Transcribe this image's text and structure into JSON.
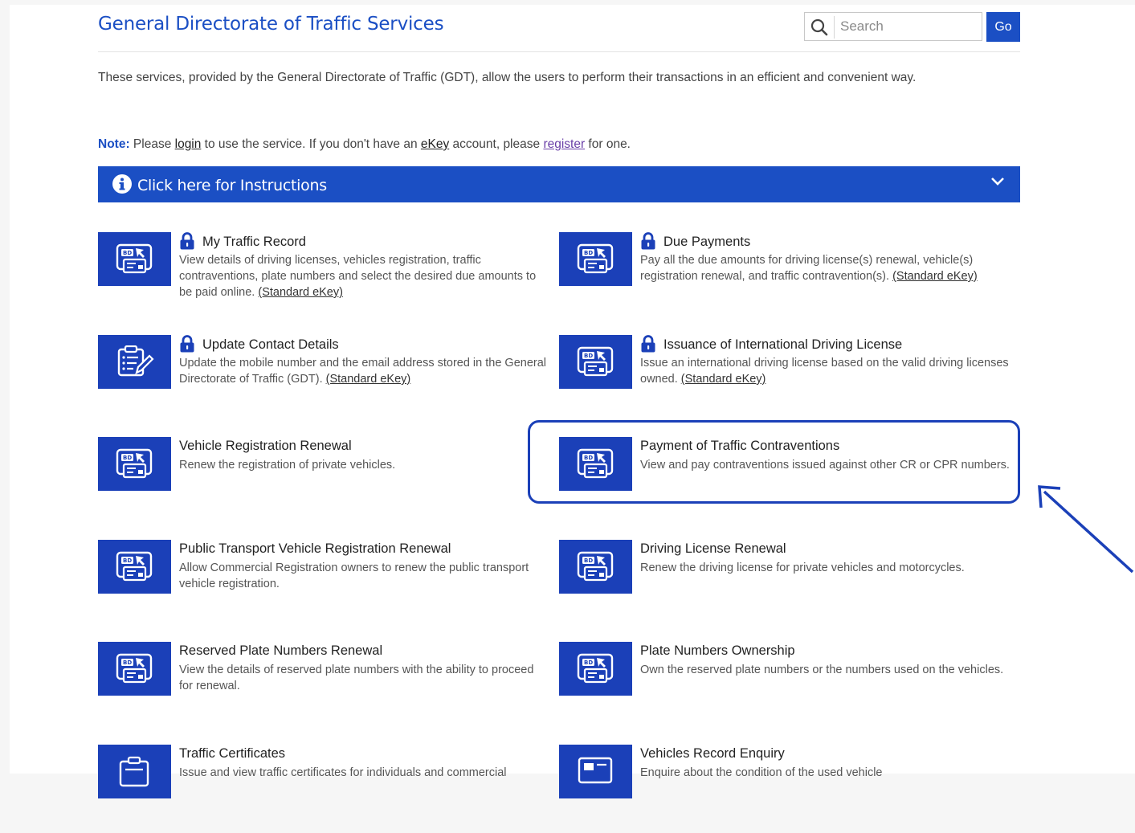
{
  "header": {
    "title": "General Directorate of Traffic Services",
    "search_placeholder": "Search",
    "go_label": "Go"
  },
  "intro": "These services, provided by the General Directorate of Traffic (GDT), allow the users to perform their transactions in an efficient and convenient way.",
  "note": {
    "label": "Note:",
    "t1": " Please ",
    "login": "login",
    "t2": " to use the service. If you don't have an ",
    "ekey": "eKey",
    "t3": " account, please ",
    "register": "register",
    "t4": " for one."
  },
  "instructions": {
    "label": "Click here for Instructions"
  },
  "services": [
    {
      "title": "My Traffic Record",
      "locked": true,
      "desc": "View details of driving licenses, vehicles registration, traffic contraventions, plate numbers and select the desired due amounts to be paid online. ",
      "ekey": "(Standard eKey)"
    },
    {
      "title": "Due Payments",
      "locked": true,
      "desc": "Pay all the due amounts for driving license(s) renewal, vehicle(s) registration renewal, and traffic contravention(s). ",
      "ekey": "(Standard eKey)"
    },
    {
      "title": "Update Contact Details",
      "locked": true,
      "desc": "Update the mobile number and the email address stored in the General Directorate of Traffic (GDT). ",
      "ekey": "(Standard eKey)"
    },
    {
      "title": "Issuance of International Driving License",
      "locked": true,
      "desc": "Issue an international driving license based on the valid driving licenses owned. ",
      "ekey": "(Standard eKey)"
    },
    {
      "title": "Vehicle Registration Renewal",
      "locked": false,
      "desc": "Renew the registration of private vehicles.",
      "ekey": ""
    },
    {
      "title": "Payment of Traffic Contraventions",
      "locked": false,
      "desc": "View and pay contraventions issued against other CR or CPR numbers.",
      "ekey": ""
    },
    {
      "title": "Public Transport Vehicle Registration Renewal",
      "locked": false,
      "desc": "Allow Commercial Registration owners to renew the public transport vehicle registration.",
      "ekey": ""
    },
    {
      "title": "Driving License Renewal",
      "locked": false,
      "desc": "Renew the driving license for private vehicles and motorcycles.",
      "ekey": ""
    },
    {
      "title": "Reserved Plate Numbers Renewal",
      "locked": false,
      "desc": "View the details of reserved plate numbers with the ability to proceed for renewal.",
      "ekey": ""
    },
    {
      "title": "Plate Numbers Ownership",
      "locked": false,
      "desc": "Own the reserved plate numbers or the numbers used on the vehicles.",
      "ekey": ""
    },
    {
      "title": "Traffic Certificates",
      "locked": false,
      "desc": "Issue and view traffic certificates for individuals and commercial",
      "ekey": ""
    },
    {
      "title": "Vehicles Record Enquiry",
      "locked": false,
      "desc": "Enquire about the condition of the used vehicle",
      "ekey": ""
    }
  ],
  "colors": {
    "primary": "#1b4fc4",
    "tile": "#1b40b8"
  }
}
